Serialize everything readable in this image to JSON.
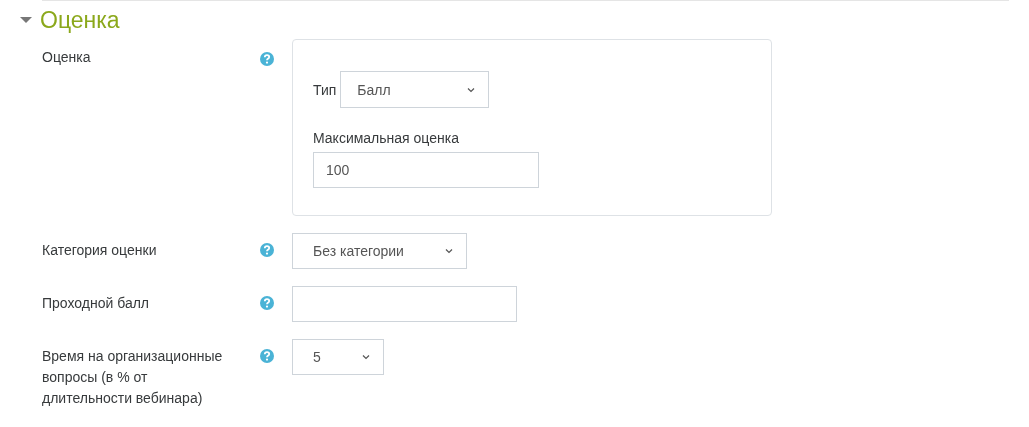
{
  "section": {
    "title": "Оценка",
    "expanded": true
  },
  "fields": [
    {
      "kind": "group",
      "label": "Оценка",
      "type_label": "Тип",
      "type_value": "Балл",
      "max_label": "Максимальная оценка",
      "max_value": "100"
    },
    {
      "kind": "select",
      "label": "Категория оценки",
      "value": "Без категории"
    },
    {
      "kind": "text",
      "label": "Проходной балл"
    },
    {
      "kind": "select",
      "label": "Время на организационные вопросы (в % от длительности вебинара)",
      "value": "5"
    }
  ]
}
